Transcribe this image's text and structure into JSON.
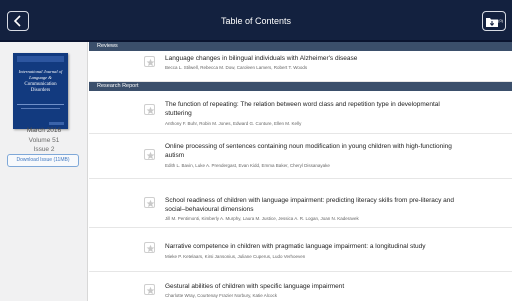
{
  "header": {
    "title": "Table of Contents",
    "download_count": "(0)",
    "colors": {
      "bar": "#13213f",
      "section": "#3b4f6b",
      "accent": "#3f77c0"
    }
  },
  "sidebar": {
    "cover": {
      "journal_line1": "International Journal of",
      "journal_line2": "Language &",
      "journal_line3": "Communication",
      "journal_line4": "Disorders"
    },
    "issue_date": "March 2016",
    "volume": "Volume 51",
    "issue": "Issue 2",
    "download_label": "Download Issue (11MB)"
  },
  "sections": [
    {
      "name": "Reviews",
      "articles": [
        {
          "title": "Language changes in bilingual individuals with Alzheimer's disease",
          "authors": "Becca L. Stilwell, Rebecca M. Dow, Caroleen Lamers, Robert T. Woods"
        }
      ]
    },
    {
      "name": "Research Report",
      "articles": [
        {
          "title": "The function of repeating: The relation between word class and repetition type in developmental stuttering",
          "authors": "Anthony F. Buhr, Robin M. Jones, Edward G. Conture, Ellen M. Kelly"
        },
        {
          "title": "Online processing of sentences containing noun modification in young children with high-functioning autism",
          "authors": "Edith L. Bavin, Luke A. Prendergast, Evan Kidd, Emma Baker, Cheryl Dissanayake"
        },
        {
          "title": "School readiness of children with language impairment: predicting literacy skills from pre-literacy and social–behavioural dimensions",
          "authors": "Jill M. Pentimonti, Kimberly A. Murphy, Laura M. Justice, Jessica A. R. Logan, Joan N. Kaderavek"
        },
        {
          "title": "Narrative competence in children with pragmatic language impairment: a longitudinal study",
          "authors": "Mieke P. Ketelaars, Kirsi Jansonius, Juliane Cuperus, Ludo Verhoeven"
        },
        {
          "title": "Gestural abilities of children with specific language impairment",
          "authors": "Charlotte Wray, Courtenay Frazier Norbury, Katie Alcock"
        }
      ]
    }
  ]
}
